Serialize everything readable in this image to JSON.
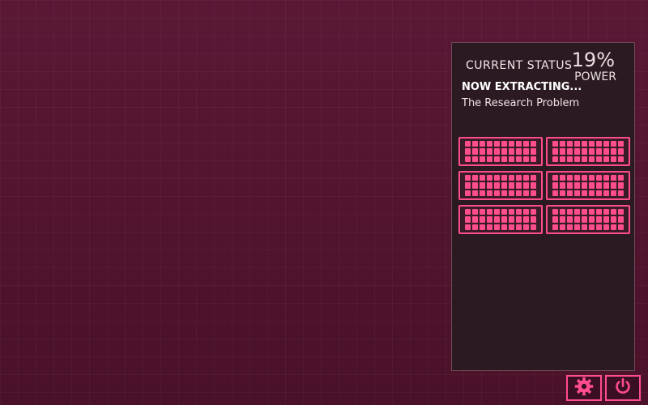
{
  "status_panel": {
    "title": "CURRENT STATUS",
    "power": {
      "value": "19%",
      "label": "POWER"
    },
    "extracting": {
      "heading": "NOW EXTRACTING...",
      "subject": "The Research Problem"
    },
    "banks": [
      {
        "id": 1,
        "fill_fraction": 1.0
      },
      {
        "id": 2,
        "fill_fraction": 1.0
      },
      {
        "id": 3,
        "fill_fraction": 1.0
      },
      {
        "id": 4,
        "fill_fraction": 1.0
      },
      {
        "id": 5,
        "fill_fraction": 1.0
      },
      {
        "id": 6,
        "fill_fraction": 1.0
      }
    ]
  },
  "controls": {
    "settings_icon": "gear-icon",
    "power_icon": "power-icon"
  },
  "colors": {
    "background": "#50152f",
    "panel": "#2b1a21",
    "accent": "#ff4d8d"
  }
}
